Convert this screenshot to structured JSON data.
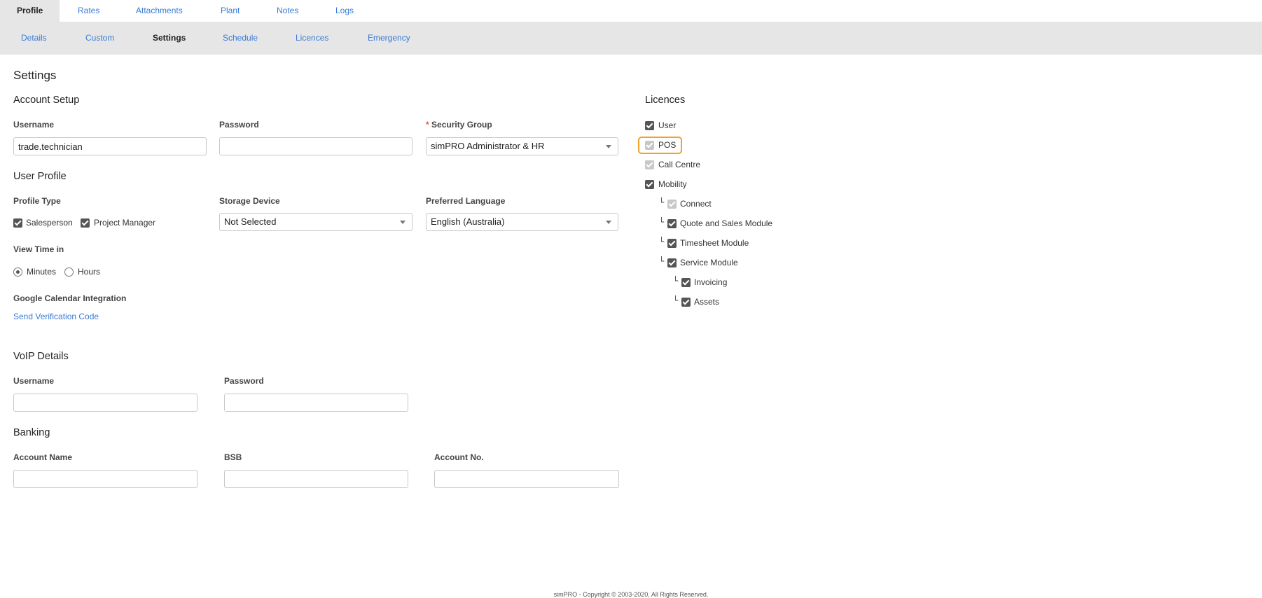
{
  "top_tabs": [
    "Profile",
    "Rates",
    "Attachments",
    "Plant",
    "Notes",
    "Logs"
  ],
  "sub_tabs": [
    "Details",
    "Custom",
    "Settings",
    "Schedule",
    "Licences",
    "Emergency"
  ],
  "page_title": "Settings",
  "account_setup": {
    "title": "Account Setup",
    "username_label": "Username",
    "username_value": "trade.technician",
    "password_label": "Password",
    "password_value": "",
    "security_group_required": "*",
    "security_group_label": "Security Group",
    "security_group_value": "simPRO Administrator & HR"
  },
  "user_profile": {
    "title": "User Profile",
    "profile_type_label": "Profile Type",
    "profile_types": [
      {
        "label": "Salesperson",
        "checked": true
      },
      {
        "label": "Project Manager",
        "checked": true
      }
    ],
    "storage_device_label": "Storage Device",
    "storage_device_value": "Not Selected",
    "preferred_language_label": "Preferred Language",
    "preferred_language_value": "English (Australia)",
    "view_time_label": "View Time in",
    "view_time_options": [
      {
        "label": "Minutes",
        "checked": true
      },
      {
        "label": "Hours",
        "checked": false
      }
    ],
    "google_calendar_label": "Google Calendar Integration",
    "send_verification_link": "Send Verification Code"
  },
  "voip": {
    "title": "VoIP Details",
    "username_label": "Username",
    "username_value": "",
    "password_label": "Password",
    "password_value": ""
  },
  "banking": {
    "title": "Banking",
    "account_name_label": "Account Name",
    "account_name_value": "",
    "bsb_label": "BSB",
    "bsb_value": "",
    "account_no_label": "Account No.",
    "account_no_value": ""
  },
  "licences": {
    "title": "Licences",
    "items": [
      {
        "label": "User",
        "checked": true,
        "disabled": false,
        "level": 0
      },
      {
        "label": "POS",
        "checked": true,
        "disabled": true,
        "level": 0,
        "highlighted": true
      },
      {
        "label": "Call Centre",
        "checked": true,
        "disabled": true,
        "level": 0
      },
      {
        "label": "Mobility",
        "checked": true,
        "disabled": false,
        "level": 0
      },
      {
        "label": "Connect",
        "checked": true,
        "disabled": true,
        "level": 1
      },
      {
        "label": "Quote and Sales Module",
        "checked": true,
        "disabled": false,
        "level": 1
      },
      {
        "label": "Timesheet Module",
        "checked": true,
        "disabled": false,
        "level": 1
      },
      {
        "label": "Service Module",
        "checked": true,
        "disabled": false,
        "level": 1
      },
      {
        "label": "Invoicing",
        "checked": true,
        "disabled": false,
        "level": 2
      },
      {
        "label": "Assets",
        "checked": true,
        "disabled": false,
        "level": 2
      }
    ],
    "tree_glyph": "└"
  },
  "footer": "simPRO - Copyright © 2003-2020, All Rights Reserved.",
  "colors": {
    "link": "#3a7bd5",
    "subnav_bg": "#e6e6e6",
    "checkbox": "#555555",
    "checkbox_disabled": "#c8c8c8",
    "highlight": "#f0a22a"
  }
}
